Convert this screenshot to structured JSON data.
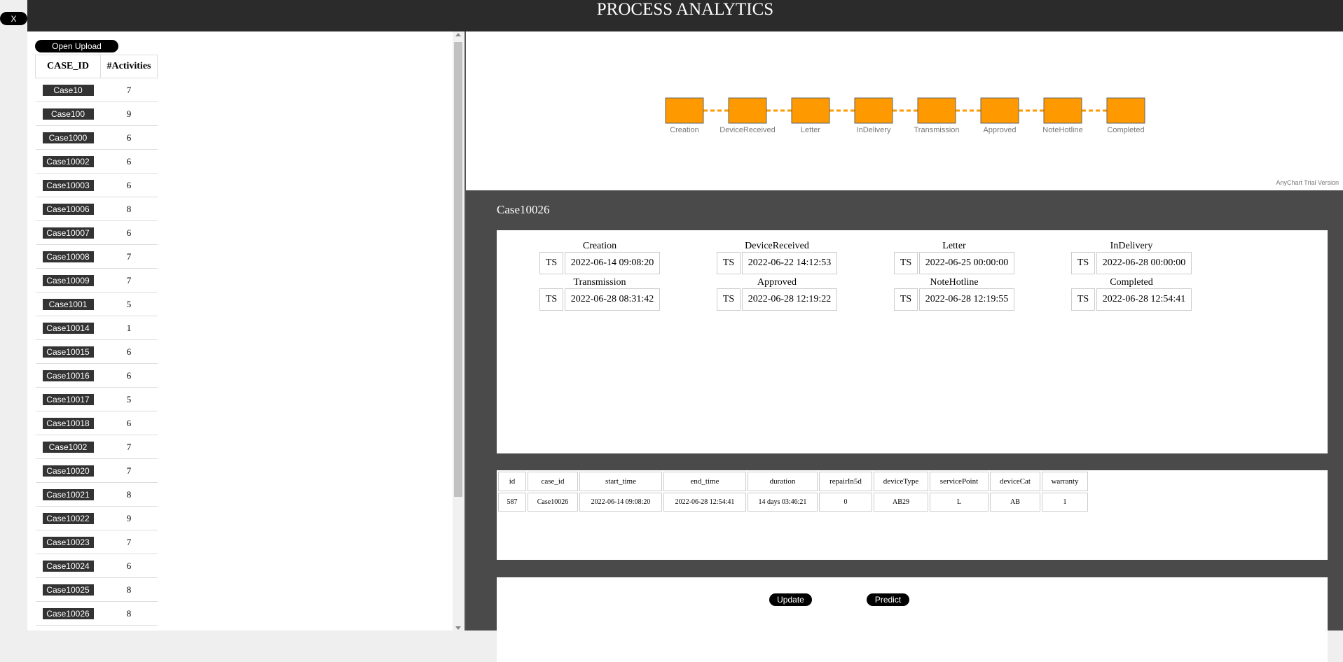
{
  "close_label": "X",
  "header": {
    "title": "PROCESS ANALYTICS"
  },
  "left": {
    "upload_label": "Open Upload",
    "columns": [
      "CASE_ID",
      "#Activities"
    ],
    "rows": [
      {
        "case": "Case10",
        "count": "7"
      },
      {
        "case": "Case100",
        "count": "9"
      },
      {
        "case": "Case1000",
        "count": "6"
      },
      {
        "case": "Case10002",
        "count": "6"
      },
      {
        "case": "Case10003",
        "count": "6"
      },
      {
        "case": "Case10006",
        "count": "8"
      },
      {
        "case": "Case10007",
        "count": "6"
      },
      {
        "case": "Case10008",
        "count": "7"
      },
      {
        "case": "Case10009",
        "count": "7"
      },
      {
        "case": "Case1001",
        "count": "5"
      },
      {
        "case": "Case10014",
        "count": "1"
      },
      {
        "case": "Case10015",
        "count": "6"
      },
      {
        "case": "Case10016",
        "count": "6"
      },
      {
        "case": "Case10017",
        "count": "5"
      },
      {
        "case": "Case10018",
        "count": "6"
      },
      {
        "case": "Case1002",
        "count": "7"
      },
      {
        "case": "Case10020",
        "count": "7"
      },
      {
        "case": "Case10021",
        "count": "8"
      },
      {
        "case": "Case10022",
        "count": "9"
      },
      {
        "case": "Case10023",
        "count": "7"
      },
      {
        "case": "Case10024",
        "count": "6"
      },
      {
        "case": "Case10025",
        "count": "8"
      },
      {
        "case": "Case10026",
        "count": "8"
      }
    ]
  },
  "process_flow": {
    "nodes": [
      "Creation",
      "DeviceReceived",
      "Letter",
      "InDelivery",
      "Transmission",
      "Approved",
      "NoteHotline",
      "Completed"
    ],
    "node_color": "#ff9900",
    "edge_color": "#ff9900",
    "watermark": "AnyChart Trial Version"
  },
  "detail": {
    "title": "Case10026",
    "ts_label": "TS",
    "activities": [
      {
        "name": "Creation",
        "ts": "2022-06-14 09:08:20"
      },
      {
        "name": "DeviceReceived",
        "ts": "2022-06-22 14:12:53"
      },
      {
        "name": "Letter",
        "ts": "2022-06-25 00:00:00"
      },
      {
        "name": "InDelivery",
        "ts": "2022-06-28 00:00:00"
      },
      {
        "name": "Transmission",
        "ts": "2022-06-28 08:31:42"
      },
      {
        "name": "Approved",
        "ts": "2022-06-28 12:19:22"
      },
      {
        "name": "NoteHotline",
        "ts": "2022-06-28 12:19:55"
      },
      {
        "name": "Completed",
        "ts": "2022-06-28 12:54:41"
      }
    ]
  },
  "info_table": {
    "columns": [
      "id",
      "case_id",
      "start_time",
      "end_time",
      "duration",
      "repairIn5d",
      "deviceType",
      "servicePoint",
      "deviceCat",
      "warranty"
    ],
    "row": [
      "587",
      "Case10026",
      "2022-06-14 09:08:20",
      "2022-06-28 12:54:41",
      "14 days 03:46:21",
      "0",
      "AB29",
      "L",
      "AB",
      "1"
    ]
  },
  "actions": {
    "update_label": "Update",
    "predict_label": "Predict"
  }
}
